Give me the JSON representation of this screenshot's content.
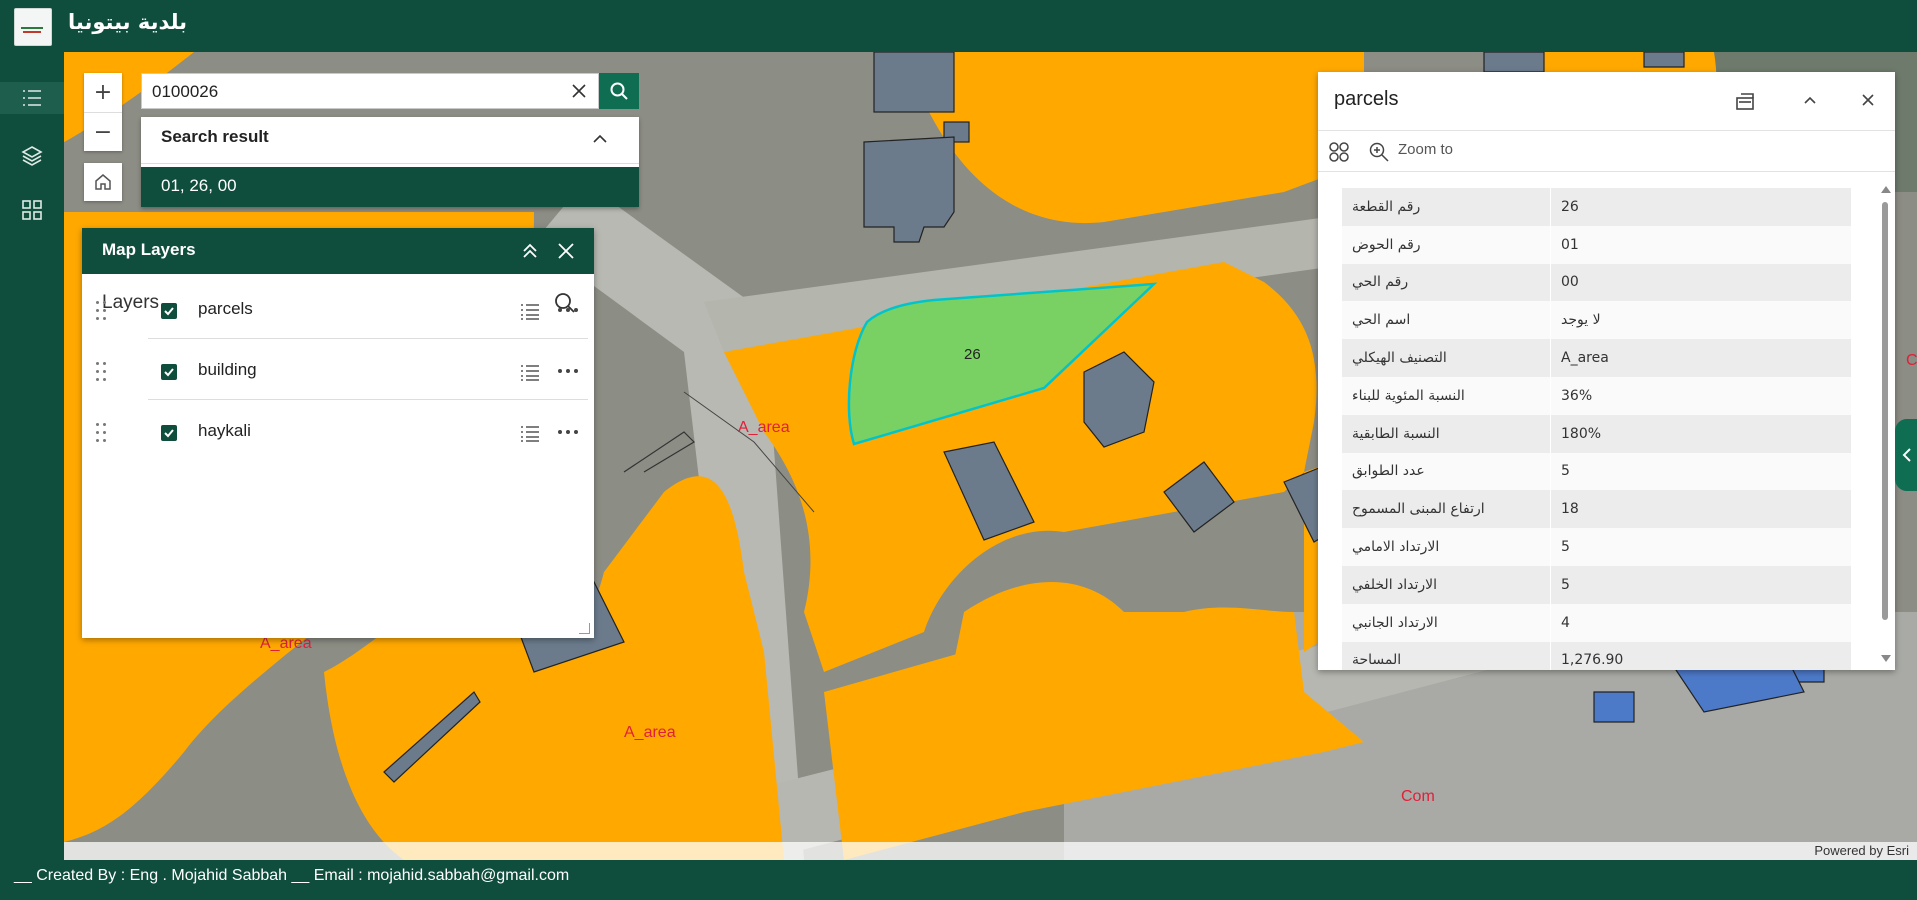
{
  "header": {
    "title": "بلدية بيتونيا",
    "logo": "municipality-logo"
  },
  "rail": {
    "items": [
      {
        "icon": "list-icon",
        "active": true
      },
      {
        "icon": "layers-icon"
      },
      {
        "icon": "grid-icon"
      }
    ]
  },
  "map": {
    "zoom_in": "+",
    "zoom_out": "−",
    "labels": {
      "a1": "A_area",
      "a2": "A_area",
      "a3": "A_area",
      "com": "Com",
      "parcel": "26",
      "c_edge": "C"
    },
    "attribution": "Powered by Esri",
    "colors": {
      "zone": "#ffa800",
      "parcel_selected": "#7ad163",
      "building": "#6b7b8c",
      "highlight": "#00c4cc"
    }
  },
  "search": {
    "value": "0100026",
    "result_title": "Search result",
    "result_item": "01, 26, 00"
  },
  "layers_panel": {
    "title": "Map Layers",
    "subtitle": "Layers",
    "layers": [
      {
        "name": "parcels"
      },
      {
        "name": "building"
      },
      {
        "name": "haykali"
      }
    ]
  },
  "parcels_panel": {
    "title": "parcels",
    "zoom_to": "Zoom to",
    "attributes": [
      {
        "k": "رقم القطعة",
        "v": "26"
      },
      {
        "k": "رقم الحوض",
        "v": "01"
      },
      {
        "k": "رقم الحي",
        "v": "00"
      },
      {
        "k": "اسم الحي",
        "v": "لا يوجد"
      },
      {
        "k": "التصنيف الهيكلي",
        "v": "A_area"
      },
      {
        "k": "النسبة المئوية للبناء",
        "v": "36%"
      },
      {
        "k": "النسبة الطابقية",
        "v": "180%"
      },
      {
        "k": "عدد الطوابق",
        "v": "5"
      },
      {
        "k": "ارتفاع المبنى المسموح",
        "v": "18"
      },
      {
        "k": "الارتداد الامامي",
        "v": "5"
      },
      {
        "k": "الارتداد الخلفي",
        "v": "5"
      },
      {
        "k": "الارتداد الجانبي",
        "v": "4"
      },
      {
        "k": "المساحة",
        "v": "1,276.90"
      }
    ]
  },
  "footer": {
    "text": "__ Created By : Eng . Mojahid Sabbah  __  Email : mojahid.sabbah@gmail.com"
  }
}
